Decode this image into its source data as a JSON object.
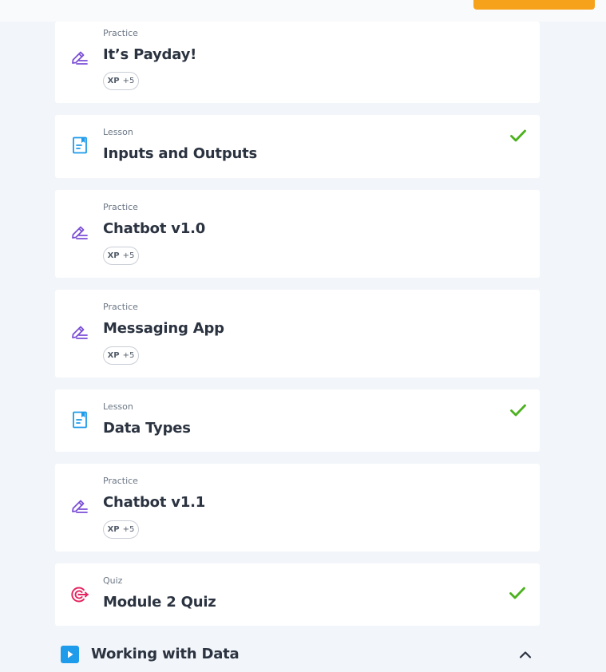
{
  "colors": {
    "accent": "#f7a21b",
    "practice_icon": "#7b4fd6",
    "lesson_icon": "#1e9bea",
    "quiz_icon": "#e4235f",
    "check": "#4bb11d",
    "play_bg": "#1e9bea"
  },
  "items": [
    {
      "type": "Practice",
      "title": "It’s Payday!",
      "xp_label": "XP",
      "xp_value": "+5",
      "icon": "edit-pencil-icon"
    },
    {
      "type": "Lesson",
      "title": "Inputs and Outputs",
      "completed": true,
      "icon": "document-icon"
    },
    {
      "type": "Practice",
      "title": "Chatbot v1.0",
      "xp_label": "XP",
      "xp_value": "+5",
      "icon": "edit-pencil-icon"
    },
    {
      "type": "Practice",
      "title": "Messaging App",
      "xp_label": "XP",
      "xp_value": "+5",
      "icon": "edit-pencil-icon"
    },
    {
      "type": "Lesson",
      "title": "Data Types",
      "completed": true,
      "icon": "document-icon"
    },
    {
      "type": "Practice",
      "title": "Chatbot v1.1",
      "xp_label": "XP",
      "xp_value": "+5",
      "icon": "edit-pencil-icon"
    },
    {
      "type": "Quiz",
      "title": "Module 2 Quiz",
      "completed": true,
      "icon": "target-icon"
    }
  ],
  "next_section": {
    "title": "Working with Data",
    "icon": "play-icon",
    "expanded": true
  }
}
